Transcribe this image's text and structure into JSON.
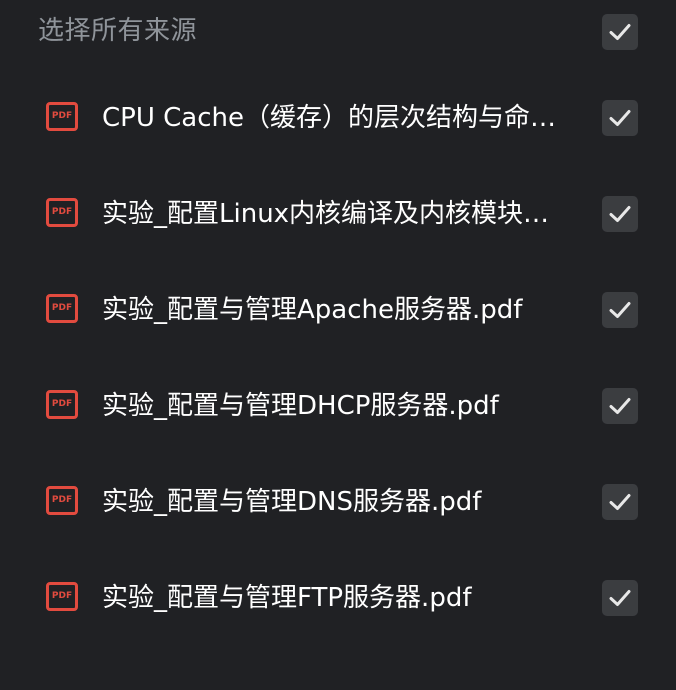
{
  "header": {
    "label": "选择所有来源",
    "select_all_checked": true
  },
  "icons": {
    "pdf_badge_text": "PDF"
  },
  "colors": {
    "background": "#202124",
    "pdf_icon": "#e24b3f",
    "checkbox_bg": "#3b3d40",
    "checkmark": "#e8e8e8",
    "header_text": "#8f949a",
    "item_text": "#ffffff"
  },
  "sources": [
    {
      "title": "CPU Cache（缓存）的层次结构与命…",
      "icon": "pdf-icon",
      "checked": true
    },
    {
      "title": "实验_配置Linux内核编译及内核模块…",
      "icon": "pdf-icon",
      "checked": true
    },
    {
      "title": "实验_配置与管理Apache服务器.pdf",
      "icon": "pdf-icon",
      "checked": true
    },
    {
      "title": "实验_配置与管理DHCP服务器.pdf",
      "icon": "pdf-icon",
      "checked": true
    },
    {
      "title": "实验_配置与管理DNS服务器.pdf",
      "icon": "pdf-icon",
      "checked": true
    },
    {
      "title": "实验_配置与管理FTP服务器.pdf",
      "icon": "pdf-icon",
      "checked": true
    }
  ]
}
